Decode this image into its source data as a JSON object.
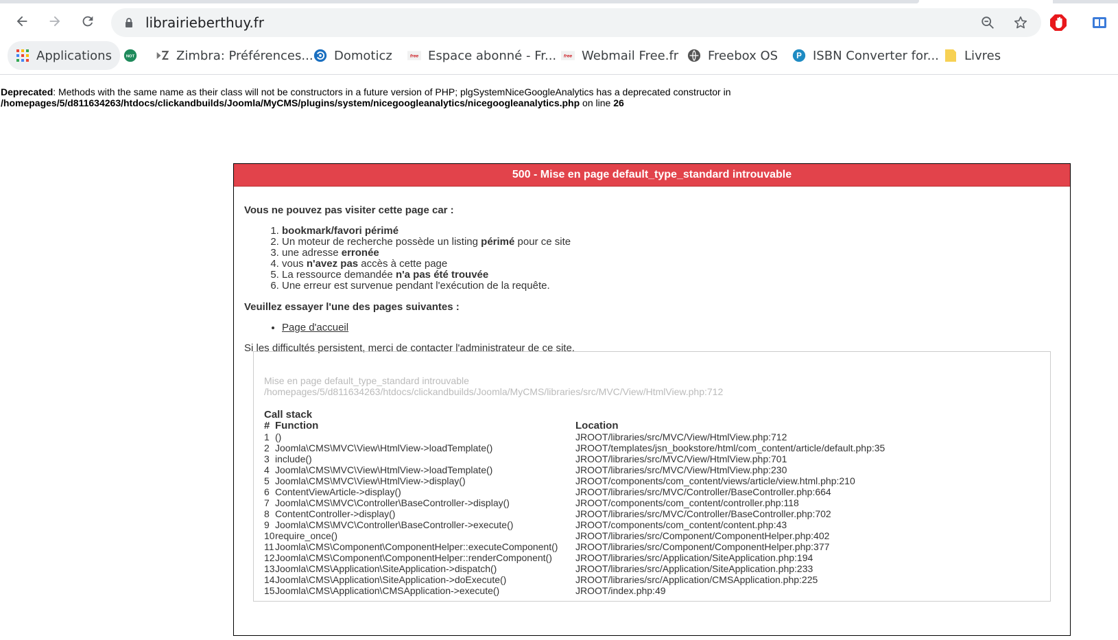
{
  "browser": {
    "url": "librairieberthuy.fr",
    "bookmarks": [
      {
        "label": "Applications",
        "icon": "apps-grid-icon"
      },
      {
        "label": "",
        "icon": "not-icon"
      },
      {
        "label": "Zimbra: Préférences...",
        "icon": "zimbra-icon"
      },
      {
        "label": "Domoticz",
        "icon": "domoticz-icon"
      },
      {
        "label": "Espace abonné - Fr...",
        "icon": "free-icon"
      },
      {
        "label": "Webmail Free.fr",
        "icon": "free-icon"
      },
      {
        "label": "Freebox OS",
        "icon": "freebox-icon"
      },
      {
        "label": "ISBN Converter for...",
        "icon": "isbn-icon"
      },
      {
        "label": "Livres",
        "icon": "folder-icon"
      }
    ]
  },
  "deprecated": {
    "label": "Deprecated",
    "text": ": Methods with the same name as their class will not be constructors in a future version of PHP; plgSystemNiceGoogleAnalytics has a deprecated constructor in",
    "path": "/homepages/5/d811634263/htdocs/clickandbuilds/Joomla/MyCMS/plugins/system/nicegoogleanalytics/nicegoogleanalytics.php",
    "online": " on line ",
    "line": "26"
  },
  "error": {
    "title": "500 - Mise en page default_type_standard introuvable",
    "cannot_visit": "Vous ne pouvez pas visiter cette page car :",
    "reasons": [
      {
        "pre": "",
        "bold": "bookmark/favori périmé",
        "post": ""
      },
      {
        "pre": "Un moteur de recherche possède un listing ",
        "bold": "périmé",
        "post": " pour ce site"
      },
      {
        "pre": "une adresse ",
        "bold": "erronée",
        "post": ""
      },
      {
        "pre": "vous ",
        "bold": "n'avez pas",
        "post": " accès à cette page"
      },
      {
        "pre": "La ressource demandée ",
        "bold": "n'a pas été trouvée",
        "post": ""
      },
      {
        "pre": "Une erreur est survenue pendant l'exécution de la requête.",
        "bold": "",
        "post": ""
      }
    ],
    "try_pages": "Veuillez essayer l'une des pages suivantes :",
    "home_link": "Page d'accueil",
    "contact": "Si les difficultés persistent, merci de contacter l'administrateur de ce site.",
    "trace_message": "Mise en page default_type_standard introuvable",
    "trace_path": "/homepages/5/d811634263/htdocs/clickandbuilds/Joomla/MyCMS/libraries/src/MVC/View/HtmlView.php:712",
    "call_stack_title": "Call stack",
    "headers": {
      "num": "#",
      "function": "Function",
      "location": "Location"
    },
    "stack": [
      {
        "n": "1",
        "fn": "()",
        "loc": "JROOT/libraries/src/MVC/View/HtmlView.php:712"
      },
      {
        "n": "2",
        "fn": "Joomla\\CMS\\MVC\\View\\HtmlView->loadTemplate()",
        "loc": "JROOT/templates/jsn_bookstore/html/com_content/article/default.php:35"
      },
      {
        "n": "3",
        "fn": "include()",
        "loc": "JROOT/libraries/src/MVC/View/HtmlView.php:701"
      },
      {
        "n": "4",
        "fn": "Joomla\\CMS\\MVC\\View\\HtmlView->loadTemplate()",
        "loc": "JROOT/libraries/src/MVC/View/HtmlView.php:230"
      },
      {
        "n": "5",
        "fn": "Joomla\\CMS\\MVC\\View\\HtmlView->display()",
        "loc": "JROOT/components/com_content/views/article/view.html.php:210"
      },
      {
        "n": "6",
        "fn": "ContentViewArticle->display()",
        "loc": "JROOT/libraries/src/MVC/Controller/BaseController.php:664"
      },
      {
        "n": "7",
        "fn": "Joomla\\CMS\\MVC\\Controller\\BaseController->display()",
        "loc": "JROOT/components/com_content/controller.php:118"
      },
      {
        "n": "8",
        "fn": "ContentController->display()",
        "loc": "JROOT/libraries/src/MVC/Controller/BaseController.php:702"
      },
      {
        "n": "9",
        "fn": "Joomla\\CMS\\MVC\\Controller\\BaseController->execute()",
        "loc": "JROOT/components/com_content/content.php:43"
      },
      {
        "n": "10",
        "fn": "require_once()",
        "loc": "JROOT/libraries/src/Component/ComponentHelper.php:402"
      },
      {
        "n": "11",
        "fn": "Joomla\\CMS\\Component\\ComponentHelper::executeComponent()",
        "loc": "JROOT/libraries/src/Component/ComponentHelper.php:377"
      },
      {
        "n": "12",
        "fn": "Joomla\\CMS\\Component\\ComponentHelper::renderComponent()",
        "loc": "JROOT/libraries/src/Application/SiteApplication.php:194"
      },
      {
        "n": "13",
        "fn": "Joomla\\CMS\\Application\\SiteApplication->dispatch()",
        "loc": "JROOT/libraries/src/Application/SiteApplication.php:233"
      },
      {
        "n": "14",
        "fn": "Joomla\\CMS\\Application\\SiteApplication->doExecute()",
        "loc": "JROOT/libraries/src/Application/CMSApplication.php:225"
      },
      {
        "n": "15",
        "fn": "Joomla\\CMS\\Application\\CMSApplication->execute()",
        "loc": "JROOT/index.php:49"
      }
    ]
  },
  "colors": {
    "error_header": "#e2434b",
    "text": "#333333",
    "muted": "#bbbbbb"
  }
}
